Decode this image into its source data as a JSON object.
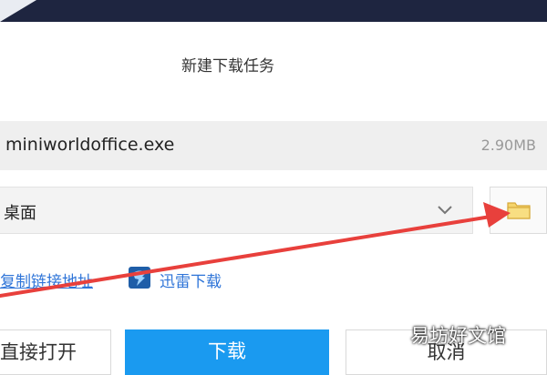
{
  "dialog": {
    "title": "新建下载任务",
    "file_name": "miniworldoffice.exe",
    "file_size": "2.90MB",
    "save_location": "桌面",
    "copy_link_label": "复制链接地址",
    "thunder_label": "迅雷下载",
    "open_button_label": "直接打开",
    "download_button_label": "下载",
    "cancel_button_label": "取消"
  },
  "icons": {
    "folder": "folder-icon",
    "chevron": "chevron-down-icon",
    "thunder": "thunder-icon"
  },
  "colors": {
    "topbar": "#1e2540",
    "download_button": "#1a9af0",
    "link": "#2e74d8",
    "arrow": "#e8403c",
    "folder": "#f5d46b"
  },
  "watermark": {
    "text": "易坊好文馆"
  }
}
